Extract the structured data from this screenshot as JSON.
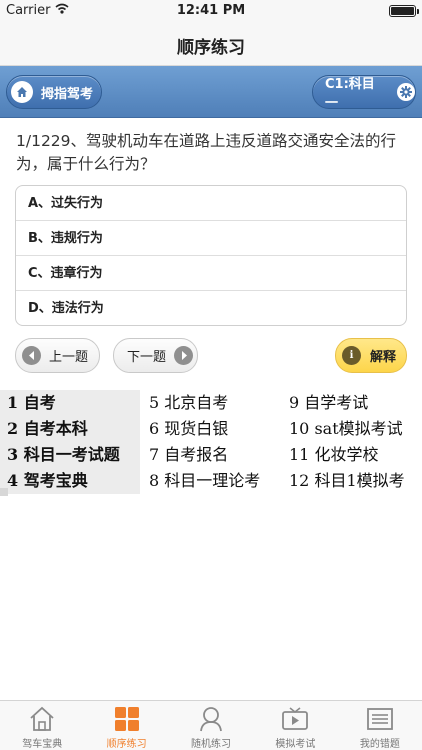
{
  "status_bar": {
    "carrier": "Carrier",
    "time": "12:41 PM"
  },
  "nav": {
    "title": "顺序练习"
  },
  "toolbar": {
    "left_label": "拇指驾考",
    "right_label": "C1:科目一"
  },
  "question": {
    "text": "1/1229、驾驶机动车在道路上违反道路交通安全法的行为，属于什么行为？"
  },
  "options": [
    {
      "label": "A、过失行为"
    },
    {
      "label": "B、违规行为"
    },
    {
      "label": "C、违章行为"
    },
    {
      "label": "D、违法行为"
    }
  ],
  "buttons": {
    "prev": "上一题",
    "next": "下一题",
    "explain": "解释"
  },
  "ads": [
    {
      "num": "1",
      "text": "自考"
    },
    {
      "num": "5",
      "text": "北京自考"
    },
    {
      "num": "9",
      "text": "自学考试"
    },
    {
      "num": "2",
      "text": "自考本科"
    },
    {
      "num": "6",
      "text": "现货白银"
    },
    {
      "num": "10",
      "text": "sat模拟考试"
    },
    {
      "num": "3",
      "text": "科目一考试题"
    },
    {
      "num": "7",
      "text": "自考报名"
    },
    {
      "num": "11",
      "text": "化妆学校"
    },
    {
      "num": "4",
      "text": "驾考宝典"
    },
    {
      "num": "8",
      "text": "科目一理论考"
    },
    {
      "num": "12",
      "text": "科目1模拟考"
    }
  ],
  "tabs": [
    {
      "label": "驾车宝典",
      "icon": "house-icon"
    },
    {
      "label": "顺序练习",
      "icon": "grid-icon"
    },
    {
      "label": "随机练习",
      "icon": "person-icon"
    },
    {
      "label": "模拟考试",
      "icon": "tv-play-icon"
    },
    {
      "label": "我的错题",
      "icon": "list-icon"
    }
  ],
  "colors": {
    "accent": "#f07f2c",
    "toolbar_blue": "#4f7fb8",
    "explain_yellow": "#fdd54a"
  }
}
